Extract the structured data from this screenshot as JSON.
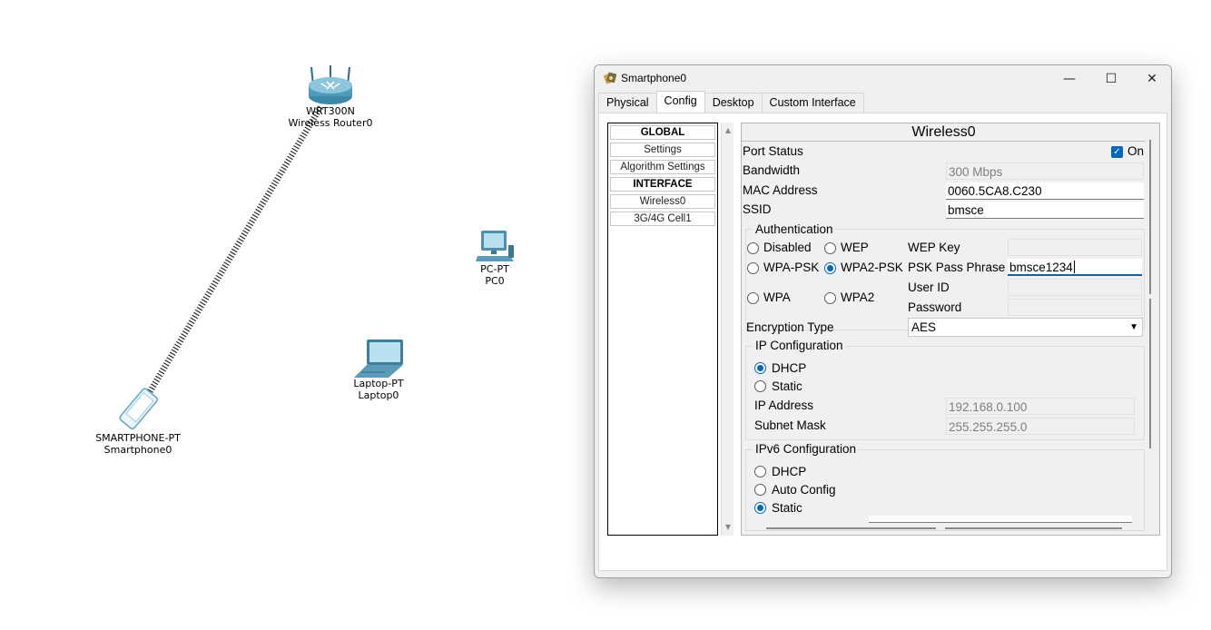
{
  "workspace": {
    "router": {
      "model": "WRT300N",
      "name": "Wireless Router0"
    },
    "pc": {
      "model": "PC-PT",
      "name": "PC0"
    },
    "laptop": {
      "model": "Laptop-PT",
      "name": "Laptop0"
    },
    "smartphone": {
      "model": "SMARTPHONE-PT",
      "name": "Smartphone0"
    }
  },
  "window": {
    "title": "Smartphone0",
    "controls": {
      "minimize": "—",
      "maximize": "☐",
      "close": "✕"
    }
  },
  "tabs": [
    {
      "label": "Physical"
    },
    {
      "label": "Config"
    },
    {
      "label": "Desktop"
    },
    {
      "label": "Custom Interface"
    }
  ],
  "active_tab": "Config",
  "nav": {
    "items": [
      {
        "label": "GLOBAL"
      },
      {
        "label": "Settings"
      },
      {
        "label": "Algorithm Settings"
      },
      {
        "label": "INTERFACE"
      },
      {
        "label": "Wireless0"
      },
      {
        "label": "3G/4G Cell1"
      }
    ]
  },
  "panel": {
    "title": "Wireless0",
    "port_status": {
      "label": "Port Status",
      "checked": true,
      "value": "On"
    },
    "bandwidth": {
      "label": "Bandwidth",
      "value": "300 Mbps"
    },
    "mac": {
      "label": "MAC Address",
      "value": "0060.5CA8.C230"
    },
    "ssid": {
      "label": "SSID",
      "value": "bmsce"
    },
    "auth": {
      "title": "Authentication",
      "options": {
        "disabled": "Disabled",
        "wep": "WEP",
        "wpa_psk": "WPA-PSK",
        "wpa2_psk": "WPA2-PSK",
        "wpa": "WPA",
        "wpa2": "WPA2"
      },
      "selected": "WPA2-PSK",
      "wep_key": {
        "label": "WEP Key",
        "value": ""
      },
      "psk": {
        "label": "PSK Pass Phrase",
        "value": "bmsce1234"
      },
      "user_id": {
        "label": "User ID",
        "value": ""
      },
      "password": {
        "label": "Password",
        "value": ""
      }
    },
    "encryption": {
      "label": "Encryption Type",
      "value": "AES"
    },
    "ip": {
      "title": "IP Configuration",
      "dhcp": "DHCP",
      "static": "Static",
      "selected": "DHCP",
      "address": {
        "label": "IP Address",
        "value": "192.168.0.100"
      },
      "mask": {
        "label": "Subnet Mask",
        "value": "255.255.255.0"
      }
    },
    "ipv6": {
      "title": "IPv6 Configuration",
      "dhcp": "DHCP",
      "auto": "Auto Config",
      "static": "Static",
      "selected": "Static"
    }
  },
  "colors": {
    "accent": "#0067c0",
    "cable": "#333333"
  }
}
